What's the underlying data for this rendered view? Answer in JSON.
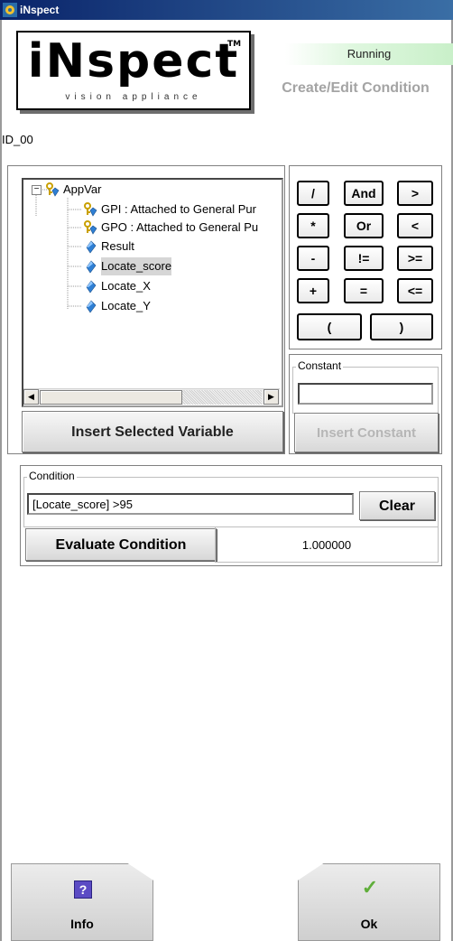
{
  "window": {
    "title": "iNspect"
  },
  "logo": {
    "word": "iNspect",
    "tm": "TM",
    "subtitle": "vision appliance"
  },
  "status": {
    "label": "Running",
    "page_title": "Create/Edit Condition"
  },
  "condition_id": "ID_00",
  "variables": {
    "tree": [
      {
        "label": "AppVar",
        "icon": "key-gem-icon",
        "level": 0,
        "expanded": true
      },
      {
        "label": "GPI : Attached to General Pur",
        "icon": "key-gem-icon",
        "level": 1
      },
      {
        "label": "GPO : Attached to General Pu",
        "icon": "key-gem-icon",
        "level": 1
      },
      {
        "label": "Result",
        "icon": "gem-icon",
        "level": 1
      },
      {
        "label": "Locate_score",
        "icon": "gem-icon",
        "level": 1,
        "selected": true
      },
      {
        "label": "Locate_X",
        "icon": "gem-icon",
        "level": 1
      },
      {
        "label": "Locate_Y",
        "icon": "gem-icon",
        "level": 1
      }
    ],
    "insert_label": "Insert Selected Variable"
  },
  "operators": [
    "/",
    "And",
    ">",
    "*",
    "Or",
    "<",
    "-",
    "!=",
    ">=",
    "+",
    "=",
    "<=",
    "(",
    ")"
  ],
  "constant": {
    "legend": "Constant",
    "value": "",
    "insert_label": "Insert Constant"
  },
  "condition": {
    "legend": "Condition",
    "value": "[Locate_score] >95",
    "clear_label": "Clear",
    "evaluate_label": "Evaluate Condition",
    "result": "1.000000"
  },
  "footer": {
    "info_label": "Info",
    "info_glyph": "?",
    "ok_label": "Ok",
    "ok_glyph": "✓"
  },
  "colors": {
    "titlebar": "#0a246a",
    "running_bg": "#c9f0c9",
    "disabled_text": "#b6b6b6",
    "info_icon_bg": "#5b4bc4",
    "ok_check": "#5fae3a"
  }
}
